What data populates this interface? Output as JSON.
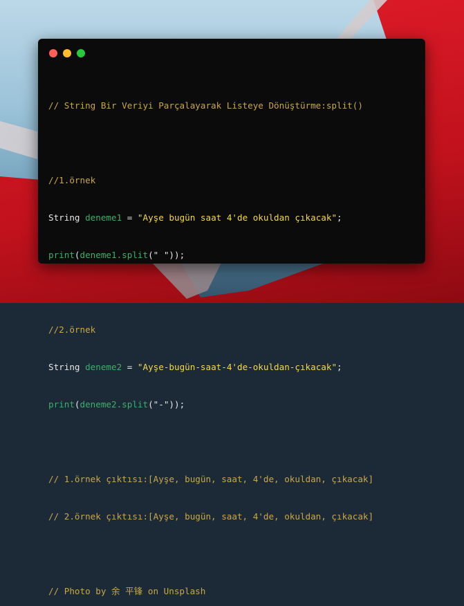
{
  "window": {
    "dots": [
      "close",
      "minimize",
      "maximize"
    ],
    "colors": {
      "close": "#ff5f56",
      "minimize": "#ffbd2e",
      "maximize": "#27c93f",
      "background": "#0b0b0c",
      "comment": "#c9a74a",
      "identifier": "#3fae6a",
      "string": "#f2d94e",
      "text": "#e8e8e8"
    }
  },
  "code": {
    "title_comment": "// String Bir Veriyi Parçalayarak Listeye Dönüştürme:split()",
    "ex1": {
      "comment": "//1.örnek",
      "type": "String",
      "var": "deneme1",
      "assign": " = ",
      "string": "\"Ayşe bugün saat 4'de okuldan çıkacak\"",
      "semi": ";",
      "print_fn": "print",
      "open": "(",
      "call_obj": "deneme1.split",
      "arg": "(\" \")",
      "close": ");"
    },
    "ex2": {
      "comment": "//2.örnek",
      "type": "String",
      "var": "deneme2",
      "assign": " = ",
      "string": "\"Ayşe-bugün-saat-4'de-okuldan-çıkacak\"",
      "semi": ";",
      "print_fn": "print",
      "open": "(",
      "call_obj": "deneme2.split",
      "arg": "(\"-\")",
      "close": ");"
    },
    "output1": "// 1.örnek çıktısı:[Ayşe, bugün, saat, 4'de, okuldan, çıkacak]",
    "output2": "// 2.örnek çıktısı:[Ayşe, bugün, saat, 4'de, okuldan, çıkacak]",
    "credit": "// Photo by 余 平锋 on Unsplash"
  }
}
